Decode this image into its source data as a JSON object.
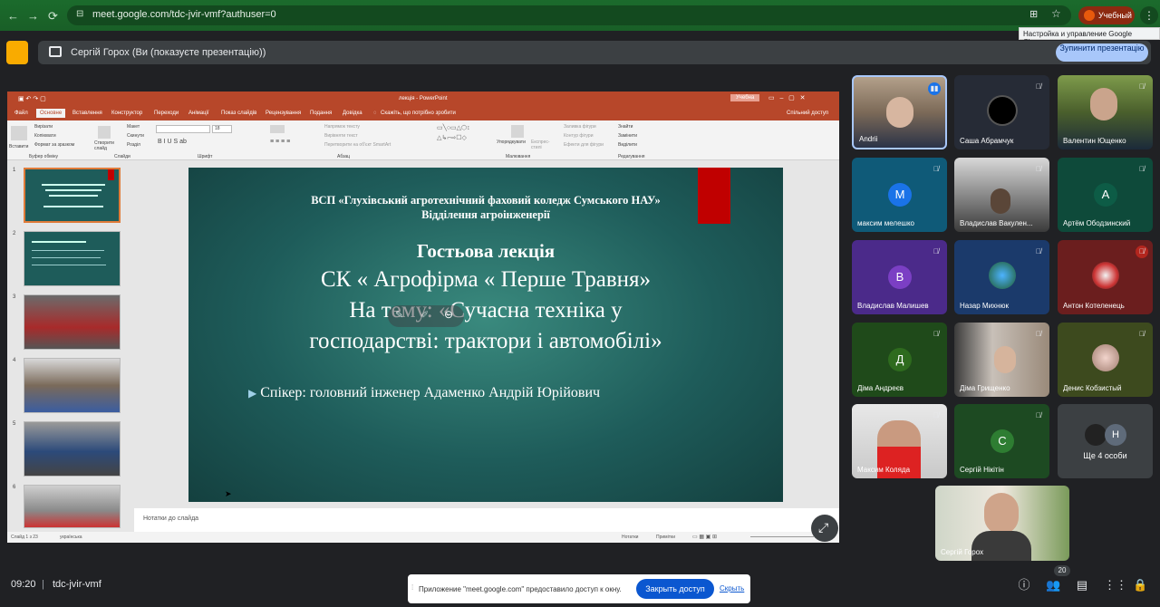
{
  "browser": {
    "url": "meet.google.com/tdc-jvir-vmf?authuser=0",
    "profile_label": "Учебный",
    "tooltip": "Настройка и управление Google Chrome"
  },
  "presentation_bar": {
    "text": "Сергій Горох (Ви (показуєте презентацію))",
    "stop_label": "Зупинити презентацію"
  },
  "ppt": {
    "window_title": "лекція - PowerPoint",
    "user_badge": "Учебна",
    "tabs": [
      "Файл",
      "Основне",
      "Вставлення",
      "Конструктор",
      "Переходи",
      "Анімації",
      "Показ слайдів",
      "Рецензування",
      "Подання",
      "Довідка"
    ],
    "search_hint": "Скажіть, що потрібно зробити",
    "share_label": "Спільний доступ",
    "ribbon": {
      "clipboard": [
        "Вставити",
        "Вирізати",
        "Копіювати",
        "Формат за зразком",
        "Буфер обміну"
      ],
      "slides": [
        "Створити слайд",
        "Макет",
        "Скинути",
        "Розділ",
        "Слайди"
      ],
      "font": "Шрифт",
      "font_size": "18",
      "paragraph": [
        "Напрямок тексту",
        "Вирівняти текст",
        "Перетворити на об'єкт SmartArt",
        "Абзац"
      ],
      "drawing": [
        "Упорядкувати",
        "Експрес-стилі",
        "Заливка фігури",
        "Контур фігури",
        "Ефекти для фігури",
        "Малювання"
      ],
      "editing": [
        "Знайти",
        "Замінити",
        "Виділити",
        "Редагування"
      ]
    },
    "thumb_numbers": [
      "1",
      "2",
      "3",
      "4",
      "5",
      "6"
    ],
    "slide": {
      "header_line1": "ВСП «Глухівський агротехнічний фаховий коледж Сумського НАУ»",
      "header_line2": "Відділення агроінженерії",
      "title1": "Гостьова лекція",
      "title2": "СК « Агрофірма « Перше Травня»",
      "title3": "На тему: «Сучасна техніка у",
      "title4": "господарстві: трактори і автомобілі»",
      "speaker": "Спікер: головний інженер Адаменко Андрій Юрійович"
    },
    "notes_placeholder": "Нотатки до слайда",
    "status": {
      "slide_of": "Слайд 1 з 23",
      "language": "українська",
      "notes": "Нотатки",
      "comments": "Примітки"
    }
  },
  "participants": [
    {
      "name": "Andrii",
      "initial": "",
      "muted": false,
      "speaking": true
    },
    {
      "name": "Саша Абрамчук",
      "initial": "",
      "muted": true
    },
    {
      "name": "Валентин Ющенко",
      "initial": "",
      "muted": true
    },
    {
      "name": "максим мелешко",
      "initial": "М",
      "muted": true,
      "color": "#1a73e8"
    },
    {
      "name": "Владислав Вакулен...",
      "initial": "",
      "muted": true
    },
    {
      "name": "Артём Ободзинский",
      "initial": "А",
      "muted": true,
      "color": "#0d5c46"
    },
    {
      "name": "Владислав Малишев",
      "initial": "В",
      "muted": true,
      "color": "#7b3fc4"
    },
    {
      "name": "Назар Михнюк",
      "initial": "",
      "muted": true
    },
    {
      "name": "Антон Котеленець",
      "initial": "",
      "muted": true
    },
    {
      "name": "Діма Андреєв",
      "initial": "Д",
      "muted": true,
      "color": "#2e6b1e"
    },
    {
      "name": "Діма Грищенко",
      "initial": "",
      "muted": true
    },
    {
      "name": "Денис Кобзистый",
      "initial": "",
      "muted": true
    },
    {
      "name": "Максим Коляда",
      "initial": "",
      "muted": true
    },
    {
      "name": "Сергій Нікітін",
      "initial": "С",
      "muted": true,
      "color": "#2e7d32"
    },
    {
      "name": "Ще 4 особи",
      "initial": "Н",
      "muted": false,
      "color": "#5f6b7a"
    }
  ],
  "self_tile": {
    "name": "Сергій Горох"
  },
  "bottom": {
    "time": "09:20",
    "meeting_code": "tdc-jvir-vmf",
    "people_count": "20"
  },
  "notice": {
    "message": "Приложение \"meet.google.com\" предоставило доступ к окну.",
    "close_label": "Закрыть доступ",
    "hide_label": "Скрыть"
  }
}
